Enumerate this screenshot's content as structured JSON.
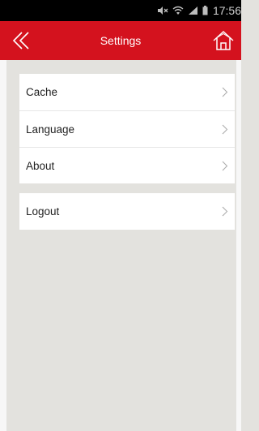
{
  "status_bar": {
    "time": "17:56"
  },
  "header": {
    "title": "Settings"
  },
  "groups": [
    {
      "items": [
        {
          "label": "Cache"
        },
        {
          "label": "Language"
        },
        {
          "label": "About"
        }
      ]
    },
    {
      "items": [
        {
          "label": "Logout"
        }
      ]
    }
  ],
  "colors": {
    "accent": "#d4121e",
    "background": "#e3e2de"
  }
}
